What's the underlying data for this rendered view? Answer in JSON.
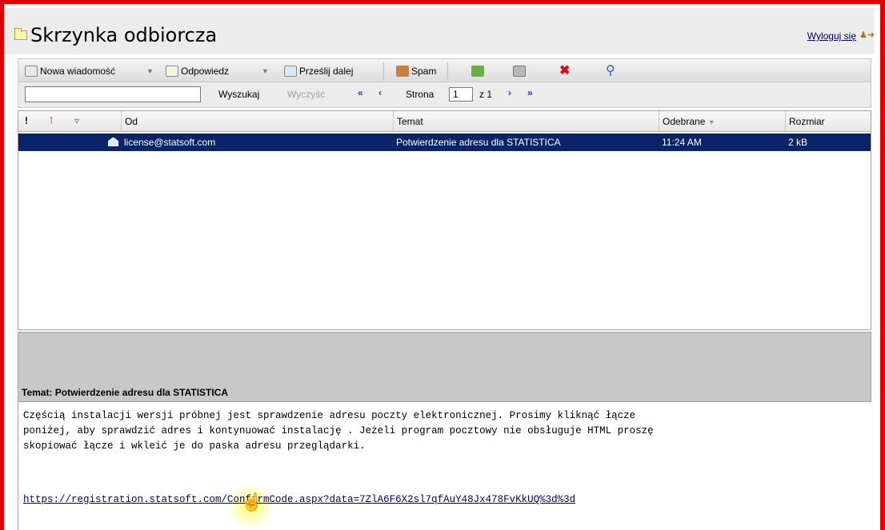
{
  "window": {
    "title": "Skrzynka odbiorcza",
    "logout_label": "Wyloguj się"
  },
  "toolbar": {
    "new_message": "Nowa wiadomość",
    "reply": "Odpowiedz",
    "forward": "Prześlij dalej",
    "spam": "Spam",
    "icons": [
      "move-icon",
      "print-icon",
      "delete-icon",
      "search-icon"
    ]
  },
  "search": {
    "value": "",
    "search_button": "Wyszukaj",
    "clear_button": "Wyczyść",
    "page_label": "Strona",
    "page_value": "1",
    "page_of": "z 1"
  },
  "list": {
    "columns": {
      "from": "Od",
      "subject": "Temat",
      "received": "Odebrane",
      "size": "Rozmiar"
    },
    "rows": [
      {
        "from": "license@statsoft.com",
        "subject": "Potwierdzenie adresu dla STATISTICA",
        "received": "11:24 AM",
        "size": "2 kB"
      }
    ]
  },
  "preview": {
    "subject_line": "Temat: Potwierdzenie adresu dla STATISTICA",
    "body": "Częścią instalacji wersji próbnej jest sprawdzenie adresu poczty elektronicznej. Prosimy kliknąć łącze\nponiżej, aby sprawdzić adres i kontynuować instalację . Jeżeli program pocztowy nie obsługuje HTML proszę\nskopiować łącze i wkleić je do paska adresu przeglądarki.",
    "link": "https://registration.statsoft.com/ConfirmCode.aspx?data=7ZlA6F6X2sl7qfAuY48Jx478FvKkUQ%3d%3d"
  },
  "colors": {
    "selection": "#0a246a",
    "frame": "#e00000",
    "link": "#00006e"
  }
}
